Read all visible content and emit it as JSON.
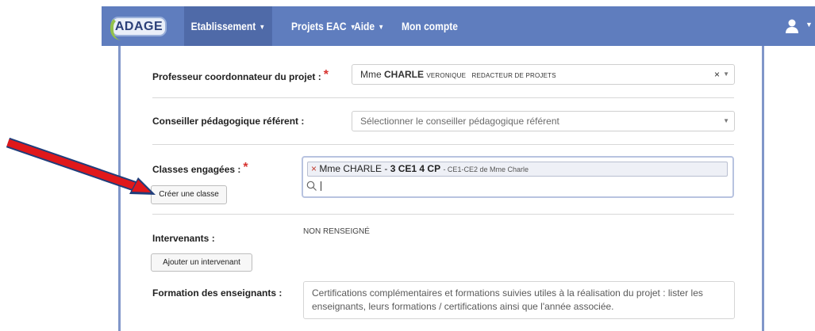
{
  "nav": {
    "logo": "ADAGE",
    "menus": [
      {
        "label": "Etablissement"
      },
      {
        "label": "Projets EAC"
      },
      {
        "label": "Aide"
      },
      {
        "label": "Mon compte"
      }
    ]
  },
  "form": {
    "coordinator": {
      "label": "Professeur coordonnateur du projet :",
      "required": "*",
      "title": "Mme",
      "surname": "CHARLE",
      "firstname": "VERONIQUE",
      "role": "REDACTEUR DE PROJETS",
      "clear": "×"
    },
    "advisor": {
      "label": "Conseiller pédagogique référent :",
      "placeholder": "Sélectionner le conseiller pédagogique référent"
    },
    "classes": {
      "label": "Classes engagées :",
      "required": "*",
      "tag_remove": "×",
      "tag_teacher": "Mme CHARLE -",
      "tag_class": "3 CE1 4 CP",
      "tag_detail": "- CE1-CE2 de Mme Charle",
      "create_button": "Créer une classe"
    },
    "interveners": {
      "label": "Intervenants :",
      "value": "NON RENSEIGNÉ",
      "add_button": "Ajouter un intervenant"
    },
    "training": {
      "label": "Formation des enseignants :",
      "placeholder_line1": "Certifications complémentaires et formations suivies utiles à la réalisation du projet : lister les",
      "placeholder_line2": "enseignants, leurs formations / certifications ainsi que l'année associée."
    }
  },
  "colors": {
    "navbar": "#5f7dbe",
    "panel_border": "#8196c9",
    "required": "#d7332f",
    "arrow": "#e0181b"
  }
}
